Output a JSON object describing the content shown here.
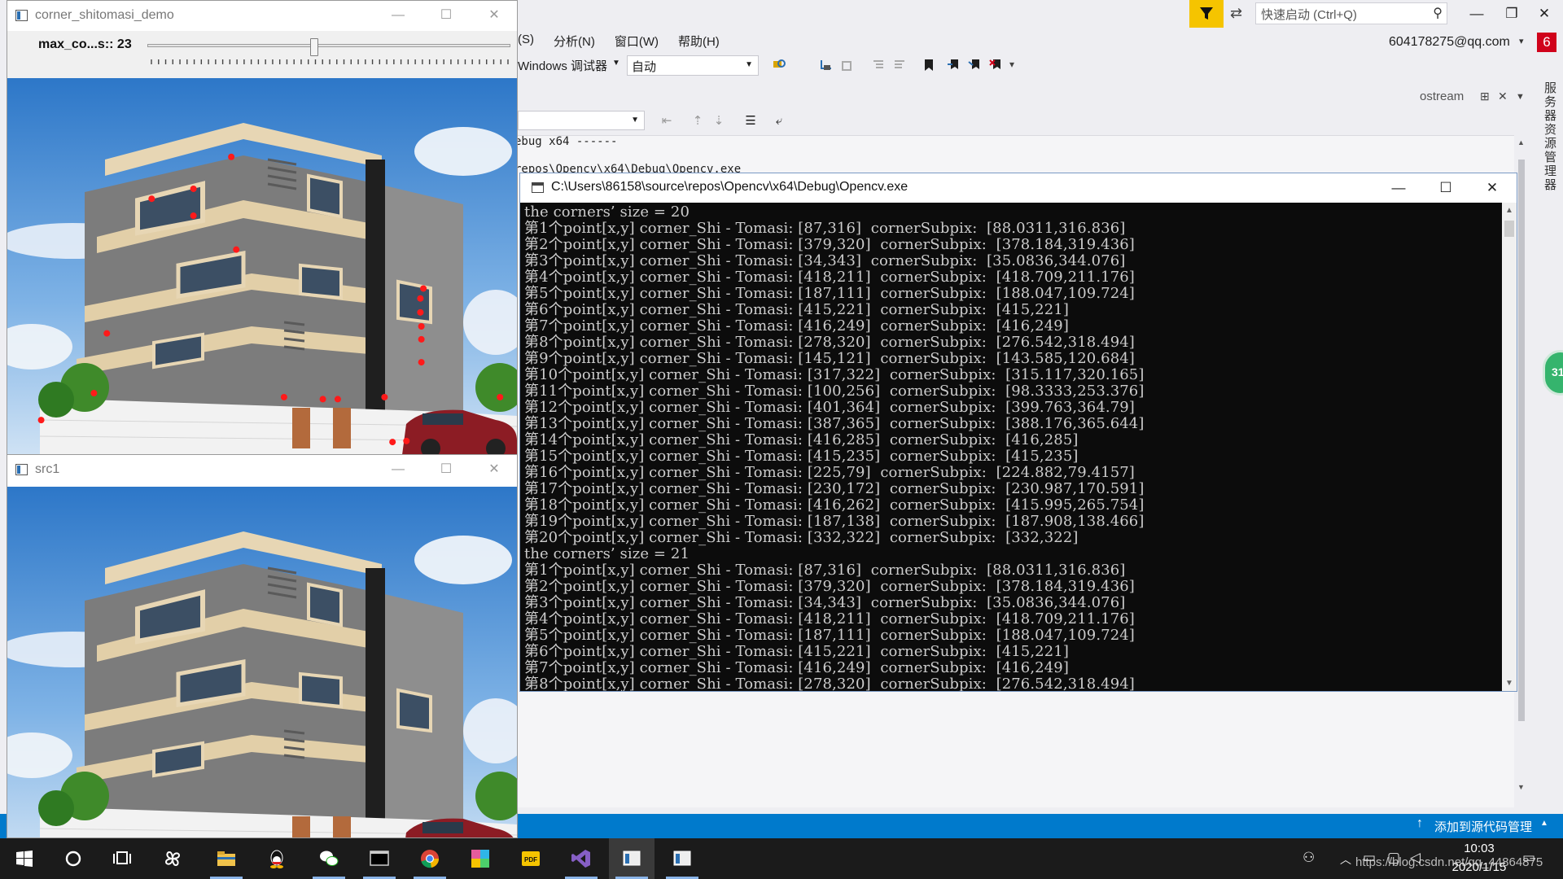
{
  "vs": {
    "quick_launch_placeholder": "快速启动 (Ctrl+Q)",
    "menu": [
      "(S)",
      "分析(N)",
      "窗口(W)",
      "帮助(H)"
    ],
    "account": "604178275@qq.com",
    "notification_count": "6",
    "debugger_label": "Windows 调试器",
    "config_value": "自动",
    "output_tab_label": "ostream",
    "output_lines": [
      "ebug x64 ------",
      "repos\\Opencv\\x64\\Debug\\Opencv.exe"
    ],
    "side_tab_label": "服务器资源管理器",
    "green_badge": "31",
    "status_right": "添加到源代码管理",
    "colors": {
      "accent": "#007acc",
      "filter": "#f5c400",
      "notification": "#d0021b"
    }
  },
  "corner_window": {
    "title": "corner_shitomasi_demo",
    "trackbar_label": "max_co...s:: 23",
    "trackbar_value": 23,
    "trackbar_max": 50
  },
  "src_window": {
    "title": "src1"
  },
  "console": {
    "title": "C:\\Users\\86158\\source\\repos\\Opencv\\x64\\Debug\\Opencv.exe",
    "lines": [
      "the corners’ size = 20",
      "第1个point[x,y] corner_Shi - Tomasi: [87,316]  cornerSubpix:  [88.0311,316.836]",
      "第2个point[x,y] corner_Shi - Tomasi: [379,320]  cornerSubpix:  [378.184,319.436]",
      "第3个point[x,y] corner_Shi - Tomasi: [34,343]  cornerSubpix:  [35.0836,344.076]",
      "第4个point[x,y] corner_Shi - Tomasi: [418,211]  cornerSubpix:  [418.709,211.176]",
      "第5个point[x,y] corner_Shi - Tomasi: [187,111]  cornerSubpix:  [188.047,109.724]",
      "第6个point[x,y] corner_Shi - Tomasi: [415,221]  cornerSubpix:  [415,221]",
      "第7个point[x,y] corner_Shi - Tomasi: [416,249]  cornerSubpix:  [416,249]",
      "第8个point[x,y] corner_Shi - Tomasi: [278,320]  cornerSubpix:  [276.542,318.494]",
      "第9个point[x,y] corner_Shi - Tomasi: [145,121]  cornerSubpix:  [143.585,120.684]",
      "第10个point[x,y] corner_Shi - Tomasi: [317,322]  cornerSubpix:  [315.117,320.165]",
      "第11个point[x,y] corner_Shi - Tomasi: [100,256]  cornerSubpix:  [98.3333,253.376]",
      "第12个point[x,y] corner_Shi - Tomasi: [401,364]  cornerSubpix:  [399.763,364.79]",
      "第13个point[x,y] corner_Shi - Tomasi: [387,365]  cornerSubpix:  [388.176,365.644]",
      "第14个point[x,y] corner_Shi - Tomasi: [416,285]  cornerSubpix:  [416,285]",
      "第15个point[x,y] corner_Shi - Tomasi: [415,235]  cornerSubpix:  [415,235]",
      "第16个point[x,y] corner_Shi - Tomasi: [225,79]  cornerSubpix:  [224.882,79.4157]",
      "第17个point[x,y] corner_Shi - Tomasi: [230,172]  cornerSubpix:  [230.987,170.591]",
      "第18个point[x,y] corner_Shi - Tomasi: [416,262]  cornerSubpix:  [415.995,265.754]",
      "第19个point[x,y] corner_Shi - Tomasi: [187,138]  cornerSubpix:  [187.908,138.466]",
      "第20个point[x,y] corner_Shi - Tomasi: [332,322]  cornerSubpix:  [332,322]",
      "the corners’ size = 21",
      "第1个point[x,y] corner_Shi - Tomasi: [87,316]  cornerSubpix:  [88.0311,316.836]",
      "第2个point[x,y] corner_Shi - Tomasi: [379,320]  cornerSubpix:  [378.184,319.436]",
      "第3个point[x,y] corner_Shi - Tomasi: [34,343]  cornerSubpix:  [35.0836,344.076]",
      "第4个point[x,y] corner_Shi - Tomasi: [418,211]  cornerSubpix:  [418.709,211.176]",
      "第5个point[x,y] corner_Shi - Tomasi: [187,111]  cornerSubpix:  [188.047,109.724]",
      "第6个point[x,y] corner_Shi - Tomasi: [415,221]  cornerSubpix:  [415,221]",
      "第7个point[x,y] corner_Shi - Tomasi: [416,249]  cornerSubpix:  [416,249]",
      "第8个point[x,y] corner_Shi - Tomasi: [278,320]  cornerSubpix:  [276.542,318.494]"
    ]
  },
  "taskbar": {
    "time": "10:03",
    "date": "2020/1/15",
    "watermark": "https://blog.csdn.net/qq_44864875",
    "apps": [
      "start-icon",
      "cortana-icon",
      "task-view-icon",
      "pinwheel-icon",
      "file-explorer-icon",
      "qq-icon",
      "wechat-icon",
      "terminal-icon",
      "chrome-icon",
      "photos-icon",
      "pdf-icon",
      "visual-studio-icon",
      "opencv-window-icon",
      "opencv-window-icon"
    ]
  }
}
